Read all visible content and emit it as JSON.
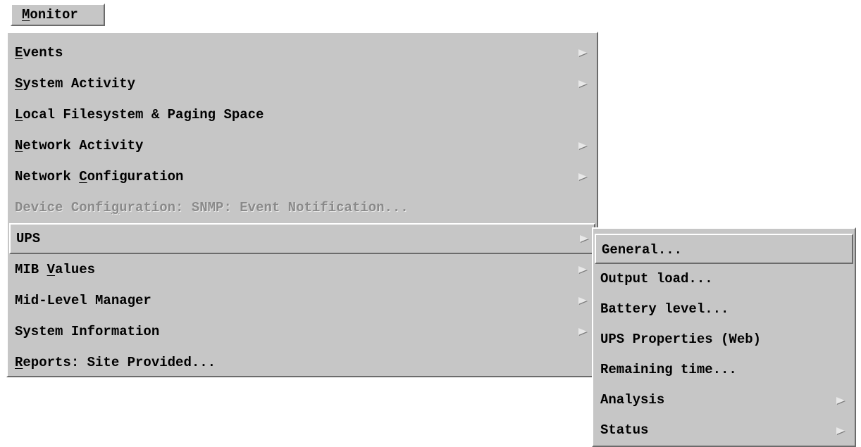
{
  "menubar": {
    "title": "Monitor",
    "mnemonic": "M",
    "rest": "onitor"
  },
  "main_menu": {
    "items": [
      {
        "pre": "",
        "mn": "E",
        "post": "vents",
        "submenu": true,
        "enabled": true
      },
      {
        "pre": "",
        "mn": "S",
        "post": "ystem Activity",
        "submenu": true,
        "enabled": true
      },
      {
        "pre": "",
        "mn": "L",
        "post": "ocal Filesystem & Paging Space",
        "submenu": false,
        "enabled": true
      },
      {
        "pre": "",
        "mn": "N",
        "post": "etwork Activity",
        "submenu": true,
        "enabled": true
      },
      {
        "pre": "Network ",
        "mn": "C",
        "post": "onfiguration",
        "submenu": true,
        "enabled": true
      },
      {
        "pre": "Device Confi",
        "mn": "g",
        "post": "uration: SNMP: Event Notification...",
        "submenu": false,
        "enabled": false
      },
      {
        "pre": "UPS",
        "mn": "",
        "post": "",
        "submenu": true,
        "enabled": true,
        "active": true
      },
      {
        "pre": "MIB ",
        "mn": "V",
        "post": "alues",
        "submenu": true,
        "enabled": true
      },
      {
        "pre": "Mid-Level Manager",
        "mn": "",
        "post": "",
        "submenu": true,
        "enabled": true
      },
      {
        "pre": "System Information",
        "mn": "",
        "post": "",
        "submenu": true,
        "enabled": true
      },
      {
        "pre": "",
        "mn": "R",
        "post": "eports: Site Provided...",
        "submenu": false,
        "enabled": true
      }
    ]
  },
  "sub_menu": {
    "items": [
      {
        "label": "General...",
        "submenu": false,
        "active": true
      },
      {
        "label": "Output load...",
        "submenu": false
      },
      {
        "label": "Battery level...",
        "submenu": false
      },
      {
        "label": "UPS Properties (Web)",
        "submenu": false
      },
      {
        "label": "Remaining time...",
        "submenu": false
      },
      {
        "label": "Analysis",
        "submenu": true
      },
      {
        "label": "Status",
        "submenu": true
      }
    ]
  }
}
